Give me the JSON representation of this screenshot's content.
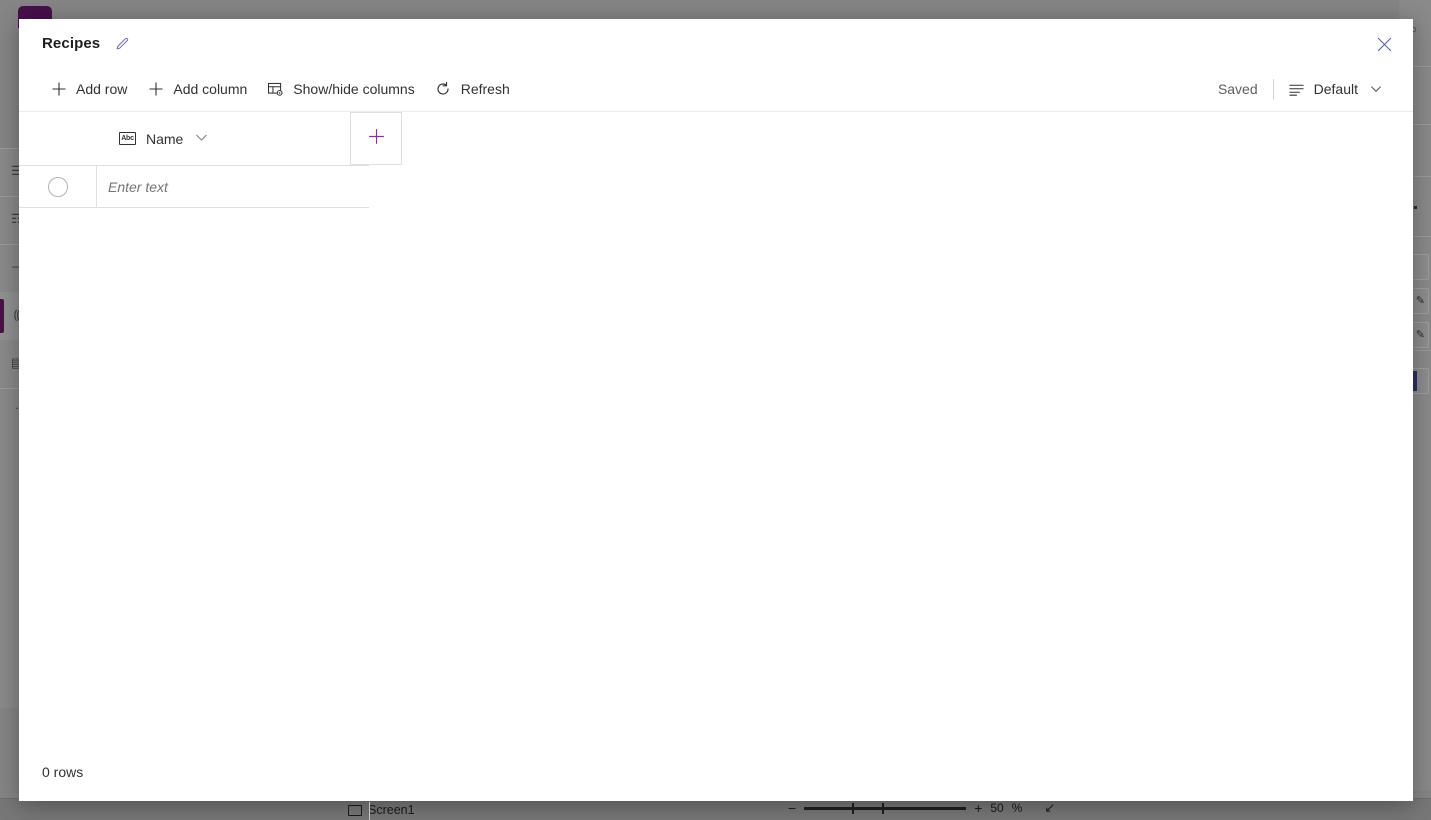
{
  "background": {
    "left_rail": {
      "items": [
        {
          "name": "hamburger-menu-icon",
          "glyph": "☰"
        },
        {
          "name": "data-icon",
          "glyph": "☶"
        },
        {
          "name": "insert-icon",
          "glyph": "─"
        },
        {
          "name": "tree-view-icon",
          "glyph": "⸨"
        },
        {
          "name": "media-icon",
          "glyph": "▤"
        },
        {
          "name": "more-icon",
          "glyph": "·"
        }
      ]
    },
    "right_panel": {
      "pencil_glyph": "✎",
      "swatch_color": "#2c2f5e"
    },
    "status_bar": {
      "screen_label": "Screen1",
      "zoom_minus": "−",
      "zoom_plus": "+",
      "zoom_value": "50",
      "zoom_unit": "%",
      "fit_icon": "↙"
    },
    "tab_color": "#46104a"
  },
  "dialog": {
    "title": "Recipes",
    "edit_icon": "pencil-icon",
    "close_icon": "close-icon",
    "toolbar": {
      "buttons": [
        {
          "id": "add-row",
          "label": "Add row",
          "icon": "plus-icon"
        },
        {
          "id": "add-column",
          "label": "Add column",
          "icon": "plus-icon"
        },
        {
          "id": "show-hide-columns",
          "label": "Show/hide columns",
          "icon": "table-settings-icon"
        },
        {
          "id": "refresh",
          "label": "Refresh",
          "icon": "refresh-icon"
        }
      ],
      "saved_label": "Saved",
      "view_label": "Default",
      "view_icon": "list-lines-icon",
      "chevron": "∨"
    },
    "grid": {
      "columns": [
        {
          "label": "Name",
          "type_badge": "Abc",
          "chevron": "∨"
        }
      ],
      "add_column_icon": "plus-icon",
      "new_row": {
        "placeholder": "Enter text",
        "value": ""
      }
    },
    "footer": {
      "rows_count": "0 rows"
    }
  },
  "colors": {
    "accent_purple": "#7a3b8f",
    "title_purple": "#46104a",
    "pencil_blue": "#6b62b5",
    "close_blue": "#5b5fa8",
    "border": "#e1dfdd",
    "text": "#323130",
    "muted": "#605e5c"
  }
}
